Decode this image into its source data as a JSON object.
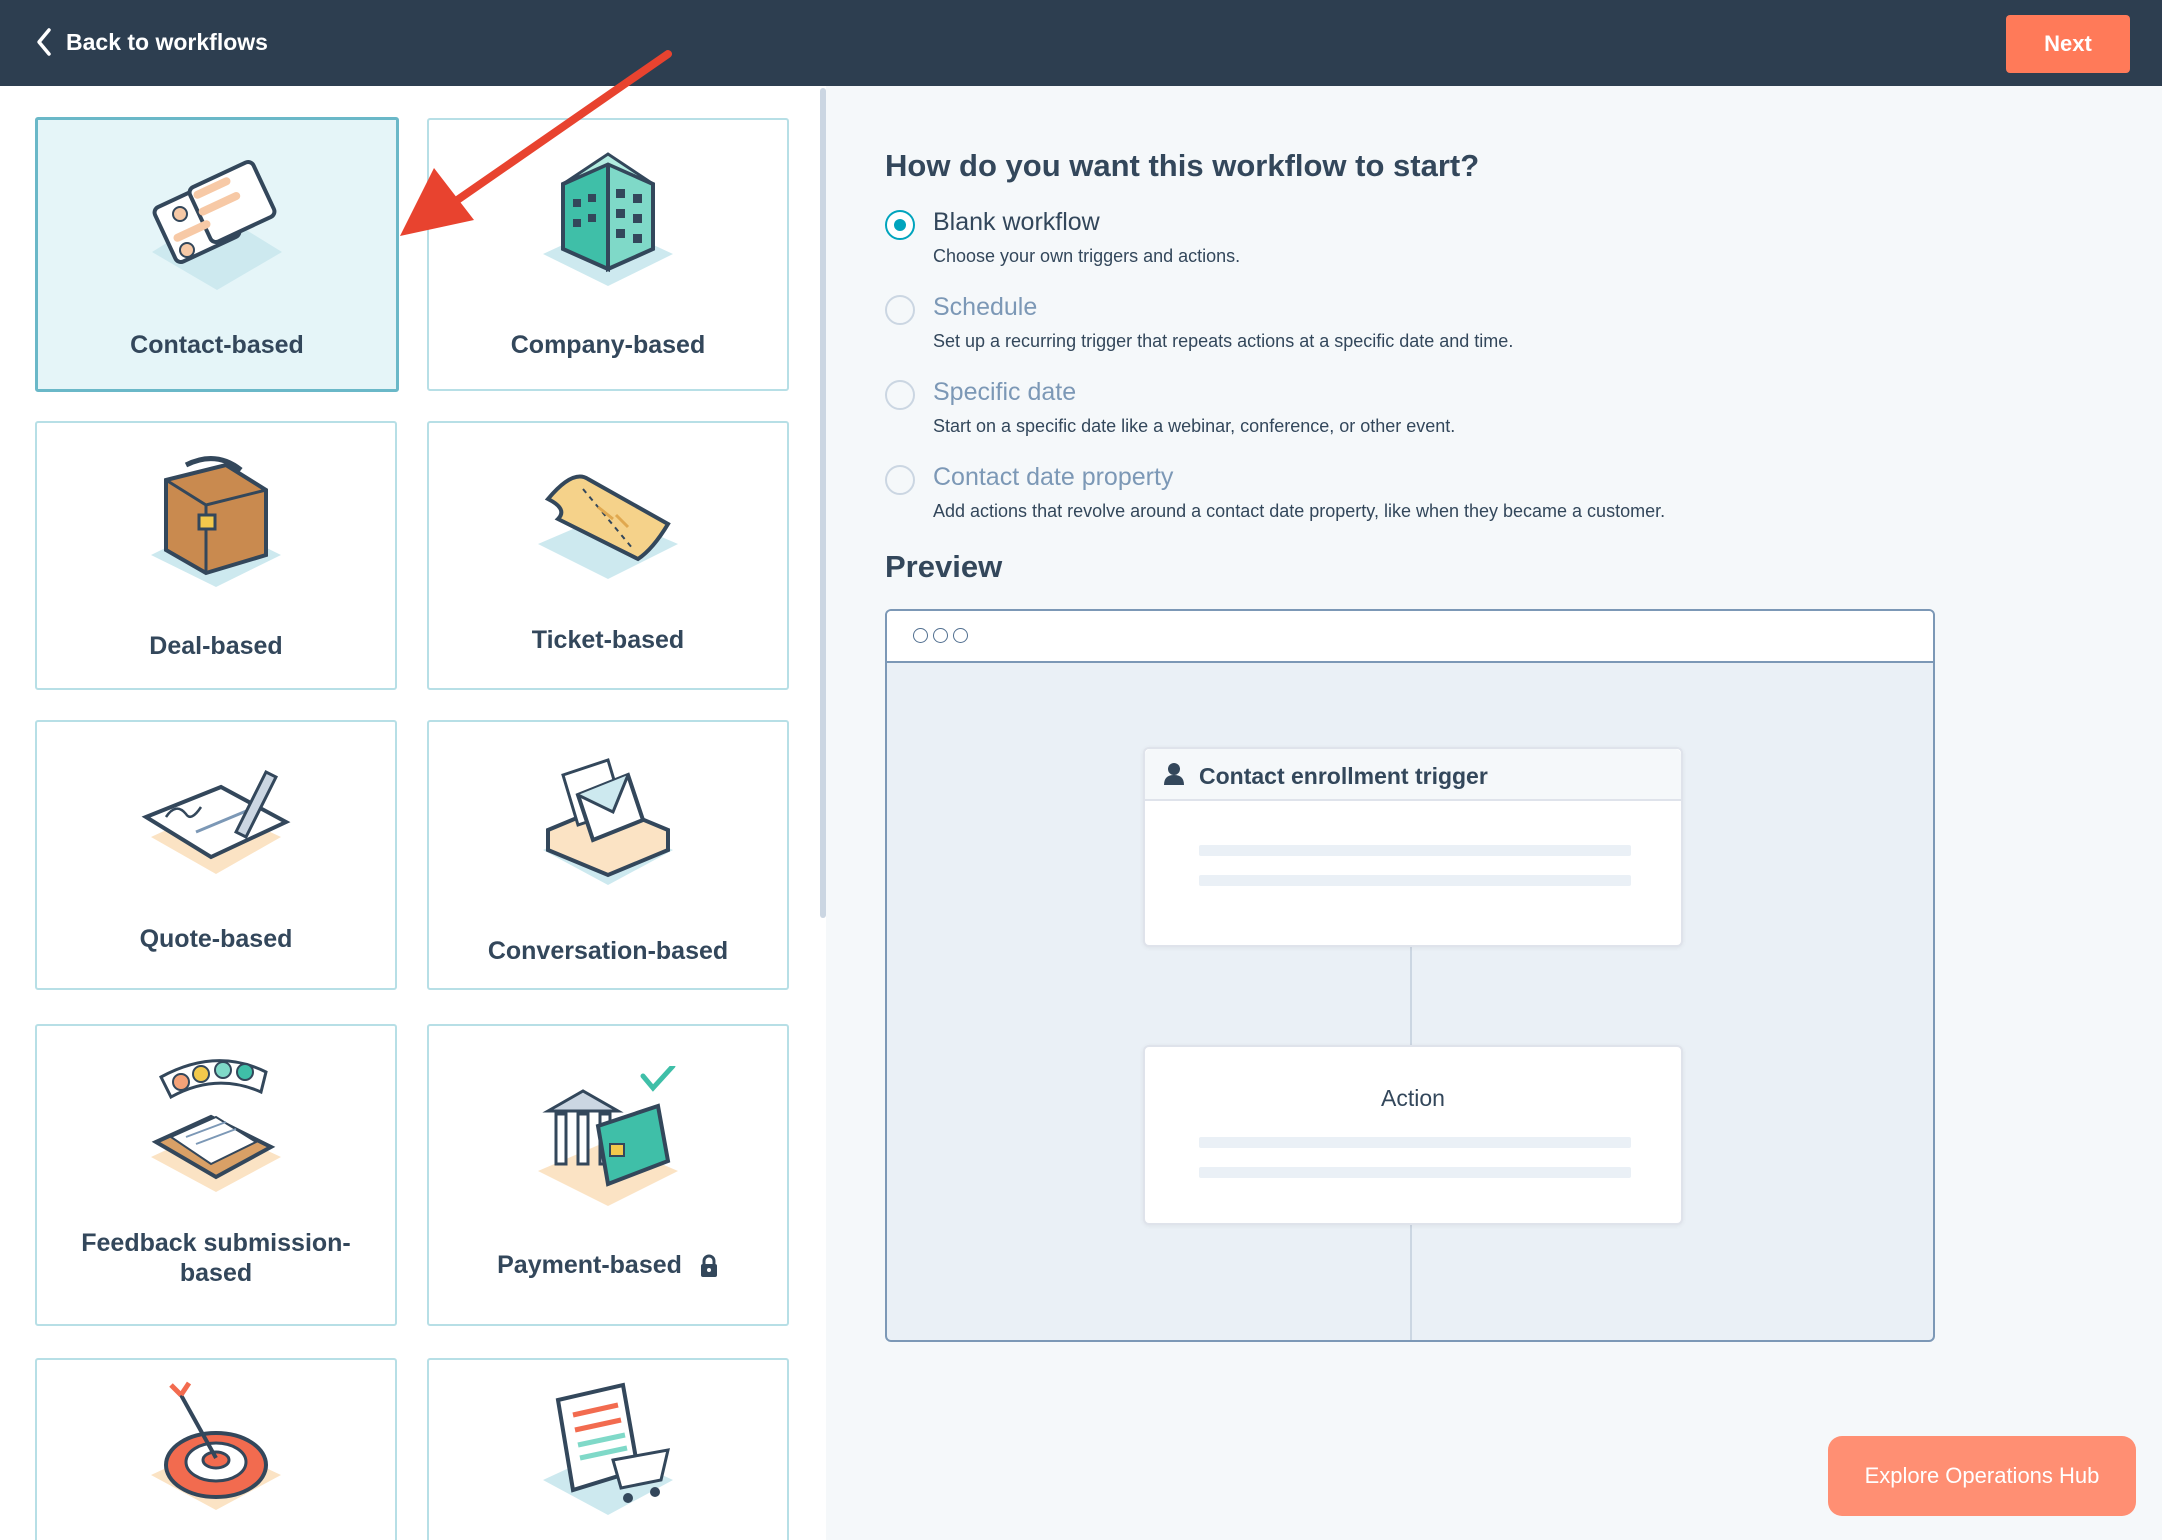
{
  "topbar": {
    "back_label": "Back to workflows",
    "next_label": "Next"
  },
  "cards": [
    {
      "label": "Contact-based",
      "selected": true
    },
    {
      "label": "Company-based",
      "selected": false
    },
    {
      "label": "Deal-based",
      "selected": false
    },
    {
      "label": "Ticket-based",
      "selected": false
    },
    {
      "label": "Quote-based",
      "selected": false
    },
    {
      "label": "Conversation-based",
      "selected": false
    },
    {
      "label_line1": "Feedback submission-",
      "label_line2": "based",
      "selected": false
    },
    {
      "label": "Payment-based",
      "selected": false,
      "locked": true
    }
  ],
  "start": {
    "question": "How do you want this workflow to start?",
    "options": [
      {
        "title": "Blank workflow",
        "desc": "Choose your own triggers and actions.",
        "selected": true
      },
      {
        "title": "Schedule",
        "desc": "Set up a recurring trigger that repeats actions at a specific date and time.",
        "selected": false
      },
      {
        "title": "Specific date",
        "desc": "Start on a specific date like a webinar, conference, or other event.",
        "selected": false
      },
      {
        "title": "Contact date property",
        "desc": "Add actions that revolve around a contact date property, like when they became a customer.",
        "selected": false
      }
    ]
  },
  "preview": {
    "title": "Preview",
    "trigger_label": "Contact enrollment trigger",
    "action_label": "Action"
  },
  "explore_label": "Explore Operations Hub",
  "colors": {
    "topbar": "#2d3e50",
    "accent": "#ff7a59",
    "teal": "#00a4bd",
    "card_border": "#b7dfe6"
  }
}
